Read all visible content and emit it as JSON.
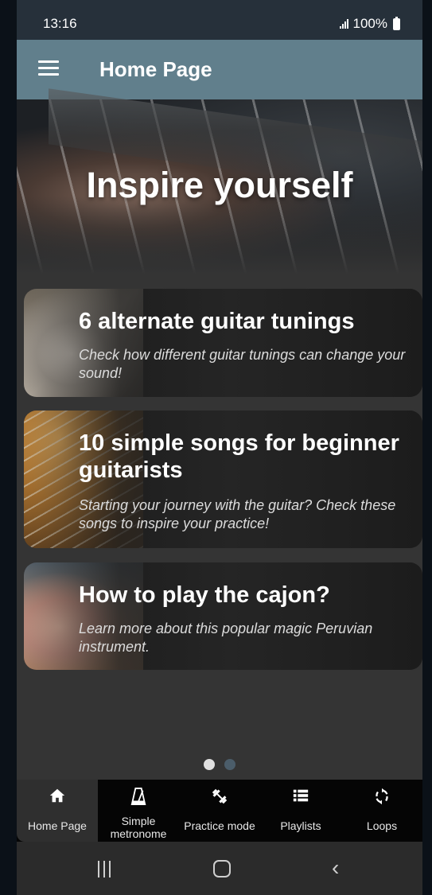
{
  "status_bar": {
    "time": "13:16",
    "battery": "100%"
  },
  "app_bar": {
    "title": "Home Page",
    "menu_icon": "hamburger-menu-icon"
  },
  "hero": {
    "title": "Inspire yourself"
  },
  "cards": [
    {
      "title": "6 alternate guitar tunings",
      "description": "Check how different guitar tunings can change your sound!"
    },
    {
      "title": "10 simple songs for beginner guitarists",
      "description": "Starting your journey with the guitar? Check these songs to inspire your practice!"
    },
    {
      "title": "How to play the cajon?",
      "description": "Learn more about this popular magic Peruvian instrument."
    }
  ],
  "pager": {
    "count": 2,
    "active_index": 0
  },
  "bottom_nav": [
    {
      "label": "Home Page",
      "icon": "home-icon",
      "active": true
    },
    {
      "label": "Simple metronome",
      "icon": "metronome-icon",
      "active": false
    },
    {
      "label": "Practice mode",
      "icon": "dumbbell-icon",
      "active": false
    },
    {
      "label": "Playlists",
      "icon": "list-icon",
      "active": false
    },
    {
      "label": "Loops",
      "icon": "loop-icon",
      "active": false
    }
  ],
  "colors": {
    "app_bar": "#617f8c",
    "background": "#343434",
    "nav_background": "#050505",
    "dot_active": "#e0e0e0",
    "dot_inactive": "#4b5d6a"
  }
}
